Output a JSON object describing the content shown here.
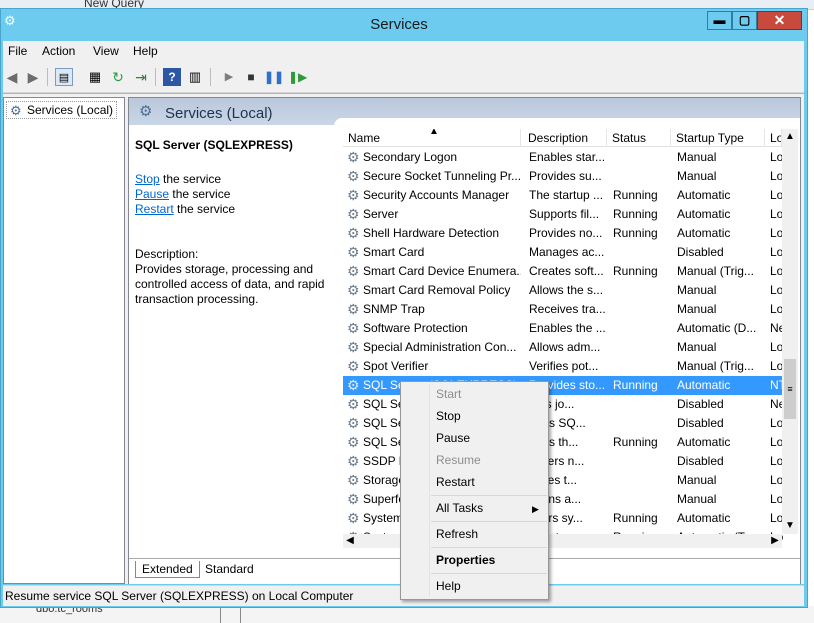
{
  "background": {
    "top_label": "New Query",
    "bottom_label": "dbo.tc_rooms"
  },
  "window": {
    "title": "Services",
    "minimize": "▬",
    "maximize": "▢",
    "close": "✕"
  },
  "menu": [
    "File",
    "Action",
    "View",
    "Help"
  ],
  "tree": {
    "root": "Services (Local)"
  },
  "panel": {
    "header": "Services (Local)",
    "selected_title": "SQL Server (SQLEXPRESS)",
    "actions": [
      {
        "link": "Stop",
        "text": " the service"
      },
      {
        "link": "Pause",
        "text": " the service"
      },
      {
        "link": "Restart",
        "text": " the service"
      }
    ],
    "description_label": "Description:",
    "description_lines": [
      "Provides storage, processing and",
      "controlled access of data, and rapid",
      "transaction processing."
    ]
  },
  "columns": [
    "Name",
    "Description",
    "Status",
    "Startup Type",
    "Lo"
  ],
  "services": [
    {
      "name": "Secondary Logon",
      "description": "Enables star...",
      "status": "",
      "startup": "Manual",
      "logon": "Lo"
    },
    {
      "name": "Secure Socket Tunneling Pr...",
      "description": "Provides su...",
      "status": "",
      "startup": "Manual",
      "logon": "Lo"
    },
    {
      "name": "Security Accounts Manager",
      "description": "The startup ...",
      "status": "Running",
      "startup": "Automatic",
      "logon": "Lo"
    },
    {
      "name": "Server",
      "description": "Supports fil...",
      "status": "Running",
      "startup": "Automatic",
      "logon": "Lo"
    },
    {
      "name": "Shell Hardware Detection",
      "description": "Provides no...",
      "status": "Running",
      "startup": "Automatic",
      "logon": "Lo"
    },
    {
      "name": "Smart Card",
      "description": "Manages ac...",
      "status": "",
      "startup": "Disabled",
      "logon": "Lo"
    },
    {
      "name": "Smart Card Device Enumera...",
      "description": "Creates soft...",
      "status": "Running",
      "startup": "Manual (Trig...",
      "logon": "Lo"
    },
    {
      "name": "Smart Card Removal Policy",
      "description": "Allows the s...",
      "status": "",
      "startup": "Manual",
      "logon": "Lo"
    },
    {
      "name": "SNMP Trap",
      "description": "Receives tra...",
      "status": "",
      "startup": "Manual",
      "logon": "Lo"
    },
    {
      "name": "Software Protection",
      "description": "Enables the ...",
      "status": "",
      "startup": "Automatic (D...",
      "logon": "Ne"
    },
    {
      "name": "Special Administration Con...",
      "description": "Allows adm...",
      "status": "",
      "startup": "Manual",
      "logon": "Lo"
    },
    {
      "name": "Spot Verifier",
      "description": "Verifies pot...",
      "status": "",
      "startup": "Manual (Trig...",
      "logon": "Lo"
    },
    {
      "name": "SQL Server (SQLEXPRESS)",
      "description": "Provides sto...",
      "status": "Running",
      "startup": "Automatic",
      "logon": "NT",
      "selected": true
    },
    {
      "name": "SQL Ser",
      "description": "utes jo...",
      "status": "",
      "startup": "Disabled",
      "logon": "Ne"
    },
    {
      "name": "SQL Ser",
      "description": "rides SQ...",
      "status": "",
      "startup": "Disabled",
      "logon": "Lo"
    },
    {
      "name": "SQL Ser",
      "description": "rides th...",
      "status": "Running",
      "startup": "Automatic",
      "logon": "Lo"
    },
    {
      "name": "SSDP D",
      "description": "covers n...",
      "status": "",
      "startup": "Disabled",
      "logon": "Lo"
    },
    {
      "name": "Storage",
      "description": "mizes t...",
      "status": "",
      "startup": "Manual",
      "logon": "Lo"
    },
    {
      "name": "Superfe",
      "description": "ntains a...",
      "status": "",
      "startup": "Manual",
      "logon": "Lo"
    },
    {
      "name": "System",
      "description": "nitors sy...",
      "status": "Running",
      "startup": "Automatic",
      "logon": "Lo"
    },
    {
      "name": "System",
      "description": "rdinates...",
      "status": "Running",
      "startup": "Automatic (T...",
      "logon": "Lo"
    }
  ],
  "tabs": [
    "Extended",
    "Standard"
  ],
  "status_bar": "Resume service SQL Server (SQLEXPRESS) on Local Computer",
  "context_menu": {
    "items": [
      {
        "label": "Start",
        "disabled": true
      },
      {
        "label": "Stop",
        "disabled": false
      },
      {
        "label": "Pause",
        "disabled": false
      },
      {
        "label": "Resume",
        "disabled": true
      },
      {
        "label": "Restart",
        "disabled": false
      },
      {
        "label": "All Tasks",
        "disabled": false,
        "submenu": true
      },
      {
        "label": "Refresh",
        "disabled": false
      },
      {
        "label": "Properties",
        "disabled": false,
        "bold": true
      },
      {
        "label": "Help",
        "disabled": false
      }
    ]
  },
  "colors": {
    "title_bar": "#6ccbef",
    "selection": "#3399ff",
    "close_button": "#c74a3c",
    "link": "#0066cc"
  }
}
